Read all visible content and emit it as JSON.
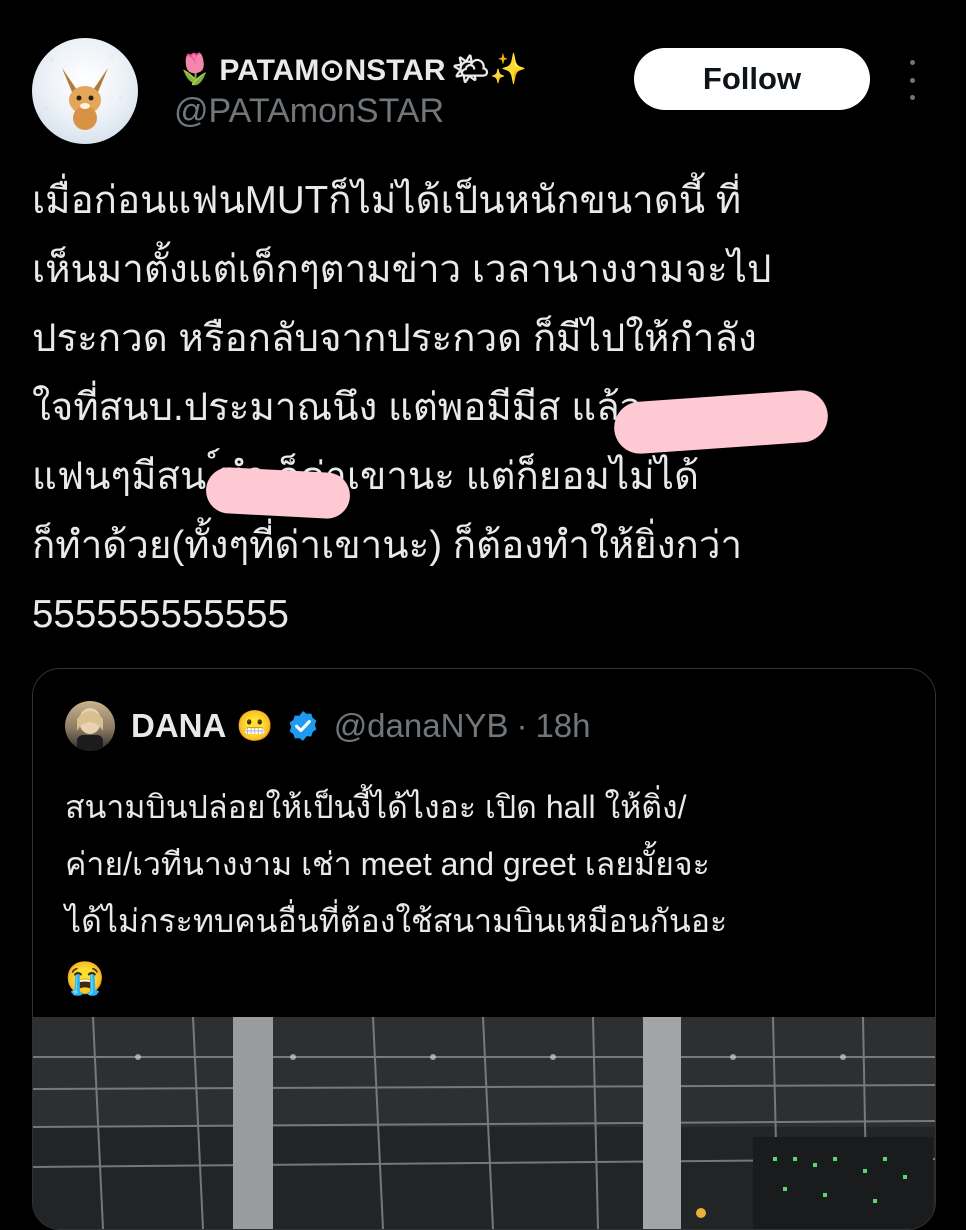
{
  "author": {
    "name": "PATAM⊙NSTAR",
    "name_prefix_emoji": "🌷",
    "name_suffix_emoji": "🌤✨",
    "handle": "@PATAmonSTAR",
    "avatar_icon": "digimon-avatar"
  },
  "follow_label": "Follow",
  "tweet_lines": [
    "เมื่อก่อนแฟนMUTก็ไม่ได้เป็นหนักขนาดนี้ ที่",
    "เห็นมาตั้งแต่เด็กๆตามข่าว เวลานางงามจะไป",
    "ประกวด หรือกลับจากประกวด ก็มีไปให้กำลัง",
    "ใจที่สนบ.ประมาณนึง แต่พอมีมีส                    แล้ว",
    "แฟนๆมีสน              ์ทำ ก็ด่าเขานะ แต่ก็ยอมไม่ได้",
    "ก็ทำด้วย(ทั้งๆที่ด่าเขานะ) ก็ต้องทำให้ยิ่งกว่า",
    "555555555555"
  ],
  "quote": {
    "name": "DANA",
    "name_emoji": "😬",
    "handle": "@danaNYB",
    "separator": "·",
    "time": "18h",
    "lines": [
      "สนามบินปล่อยให้เป็นงี้ได้ไงอะ เปิด hall ให้ติ่ง/",
      "ค่าย/เวทีนางงาม เช่า meet and greet เลยมั้ยจะ",
      "ได้ไม่กระทบคนอื่นที่ต้องใช้สนามบินเหมือนกันอะ",
      "😭"
    ],
    "verified_icon": "verified-badge-icon",
    "media": "airport-hall-photo"
  },
  "colors": {
    "background": "#000000",
    "text": "#e7e9ea",
    "muted": "#71767b",
    "censor": "#ffc9d4",
    "verified": "#1d9bf0"
  }
}
